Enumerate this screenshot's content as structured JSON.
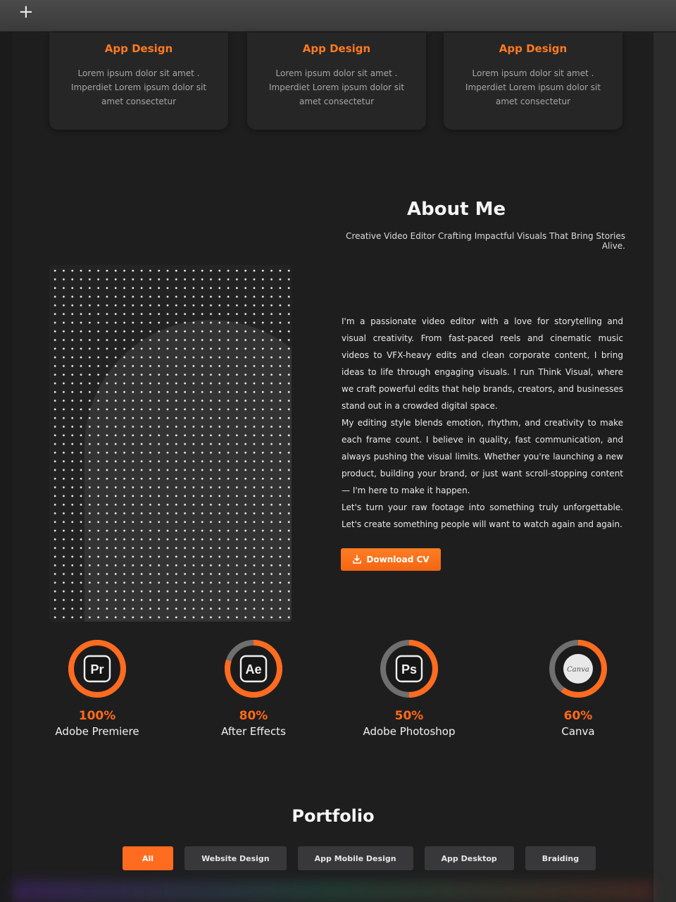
{
  "browser": {
    "new_tab_icon": "plus-icon"
  },
  "services": {
    "cards": [
      {
        "title": "App Design",
        "description": "Lorem ipsum dolor sit amet . Imperdiet Lorem ipsum dolor sit amet consectetur"
      },
      {
        "title": "App Design",
        "description": "Lorem ipsum dolor sit amet . Imperdiet Lorem ipsum dolor sit amet consectetur"
      },
      {
        "title": "App Design",
        "description": "Lorem ipsum dolor sit amet . Imperdiet Lorem ipsum dolor sit amet consectetur"
      }
    ]
  },
  "about": {
    "title": "About Me",
    "subtitle": "Creative Video Editor Crafting Impactful Visuals That Bring Stories Alive.",
    "paragraphs": [
      "I'm a passionate video editor with a love for storytelling and visual creativity. From fast-paced reels and cinematic music videos to VFX-heavy edits and clean corporate content, I bring ideas to life through engaging visuals. I run Think Visual, where we craft powerful edits that help brands, creators, and businesses stand out in a crowded digital space.",
      "My editing style blends emotion, rhythm, and creativity to make each frame count. I believe in quality, fast communication, and always pushing the visual limits. Whether you're launching a new product, building your brand, or just want scroll-stopping content — I'm here to make it happen.",
      "Let's turn your raw footage into something truly unforgettable. Let's create something people will want to watch again and again."
    ],
    "download_button": "Download CV",
    "download_icon": "download-icon"
  },
  "skills": [
    {
      "percent_label": "100%",
      "percent": 100,
      "name": "Adobe Premiere",
      "icon_text": "Pr",
      "icon": "premiere-icon"
    },
    {
      "percent_label": "80%",
      "percent": 80,
      "name": "After Effects",
      "icon_text": "Ae",
      "icon": "after-effects-icon"
    },
    {
      "percent_label": "50%",
      "percent": 50,
      "name": "Adobe Photoshop",
      "icon_text": "Ps",
      "icon": "photoshop-icon"
    },
    {
      "percent_label": "60%",
      "percent": 60,
      "name": "Canva",
      "icon_text": "Canva",
      "icon": "canva-icon"
    }
  ],
  "colors": {
    "accent": "#ff6b1f",
    "background": "#1e1e1f",
    "card": "#262627",
    "ring_track": "#6f6f6f"
  },
  "portfolio": {
    "title": "Portfolio",
    "filters": [
      "All",
      "Website Design",
      "App Mobile Design",
      "App Desktop",
      "Braiding"
    ],
    "active_filter": "All"
  }
}
